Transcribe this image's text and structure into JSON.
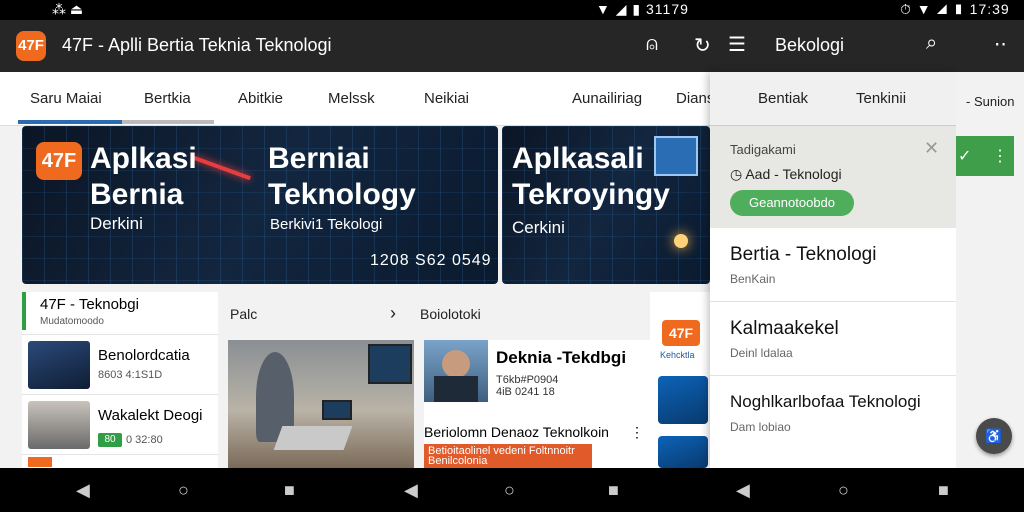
{
  "status": {
    "left": "⁂ ⏏",
    "time_mid": "31179",
    "time_right": "17:39"
  },
  "appbar": {
    "logo": "47F",
    "title": "47F - Aplli Bertia Teknia Teknologi",
    "drawer_title": "Bekologi"
  },
  "tabs": [
    "Saru Maiai",
    "Bertkia",
    "Abitkie",
    "Melssk",
    "Neikiai",
    "Aunailiriag",
    "Dians"
  ],
  "banner1": {
    "logo": "47F",
    "title_a": "Aplkasi",
    "title_b": "Bernia",
    "sub": "Derkini",
    "title2_a": "Berniai",
    "title2_b": "Teknology",
    "sub2": "Berkivi1 Tekologi",
    "num": "1208 S62 0549"
  },
  "banner2": {
    "title_a": "Aplkasali",
    "title_b": "Tekroyingy",
    "sub": "Cerkini"
  },
  "leftcol": {
    "title": "47F - Teknobgi",
    "sub": "Mudatomoodo",
    "items": [
      {
        "title": "Benolordcatia",
        "sub": "8603 4:1S1D"
      },
      {
        "title": "Wakalekt Deogi",
        "chip": "80",
        "sub": "0 32:80"
      }
    ]
  },
  "midcol": {
    "label_a": "Palc",
    "label_b": "Boiolotoki",
    "card": {
      "title": "Deknia -Tekdbgi",
      "sub1": "T6kb#P0904",
      "sub2": "4iB 0241 18",
      "headline": "Beriolomn Denaoz Teknolkoin",
      "red": "Betioitaolinel vedeni Foltnnoitr Benilcolonia"
    }
  },
  "rightstrip": {
    "logo": "47F",
    "label": "Kehcktla"
  },
  "drawer": {
    "tabs": [
      "Bentiak",
      "Tenkinii"
    ],
    "card": {
      "label": "Tadigakami",
      "sub": "Aad - Teknologi",
      "button": "Geannotoobdo"
    },
    "items": [
      {
        "title": "Bertia - Teknologi",
        "sub": "BenKain"
      },
      {
        "title": "Kalmaakekel",
        "sub": "Deinl ldalaa"
      },
      {
        "title": "Noghlkarlbofaa Teknologi",
        "sub": "Dam lobiao"
      }
    ]
  },
  "farright": {
    "label": "- Sunion"
  }
}
